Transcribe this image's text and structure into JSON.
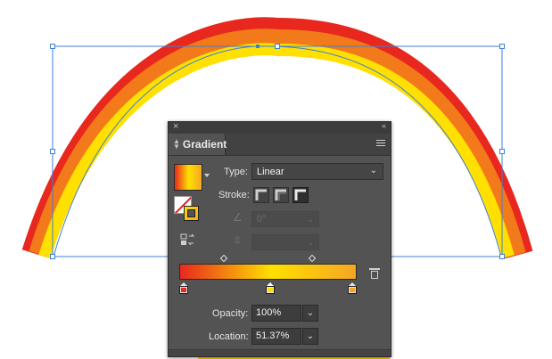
{
  "panel": {
    "tab_label": "Gradient",
    "close_glyph": "×",
    "collapse_glyph": "‹‹",
    "type_label": "Type:",
    "type_value": "Linear",
    "stroke_label": "Stroke:",
    "angle_value": "0°",
    "opacity_label": "Opacity:",
    "opacity_value": "100%",
    "location_label": "Location:",
    "location_value": "51.37%"
  },
  "gradient": {
    "stops": [
      {
        "color": "#e8281e",
        "location": 0,
        "selected": false
      },
      {
        "color": "#ffffff",
        "location": 0.5137,
        "selected": true
      },
      {
        "color": "#f5a623",
        "location": 1,
        "selected": false
      }
    ],
    "midpoints": [
      0.25,
      0.75
    ]
  },
  "colors": {
    "arc_outer": "#e8281e",
    "arc_mid": "#ffe000",
    "selection_blue": "#3d7fd6",
    "panel_bg": "#535353"
  },
  "icons": [
    "close-icon",
    "collapse-icon",
    "panel-menu-icon",
    "reverse-gradient-icon",
    "angle-icon",
    "aspect-ratio-icon",
    "trash-icon",
    "chevron-down-icon"
  ]
}
